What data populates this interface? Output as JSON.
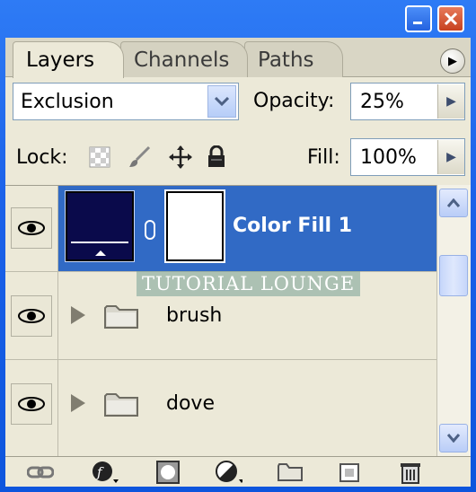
{
  "tabs": [
    {
      "label": "Layers",
      "active": true
    },
    {
      "label": "Channels",
      "active": false
    },
    {
      "label": "Paths",
      "active": false
    }
  ],
  "blend_mode": {
    "value": "Exclusion"
  },
  "opacity": {
    "label": "Opacity:",
    "value": "25%"
  },
  "lock": {
    "label": "Lock:",
    "icons": [
      "transparency-lock-icon",
      "brush-lock-icon",
      "move-lock-icon",
      "padlock-icon"
    ]
  },
  "fill": {
    "label": "Fill:",
    "value": "100%"
  },
  "layers": [
    {
      "name": "Color Fill 1",
      "type": "fill",
      "selected": true,
      "visible": true
    },
    {
      "name": "brush",
      "type": "group",
      "selected": false,
      "visible": true
    },
    {
      "name": "dove",
      "type": "group",
      "selected": false,
      "visible": true
    }
  ],
  "watermark": "TUTORIAL LOUNGE",
  "toolbar_icons": [
    "link-icon",
    "layer-style-icon",
    "mask-icon",
    "adjustment-layer-icon",
    "new-group-icon",
    "new-layer-icon",
    "trash-icon"
  ],
  "colors": {
    "selection": "#316ac5",
    "panel": "#ece9d8",
    "title_bar": "#0a54e4",
    "fill_swatch": "#0a0a4b"
  }
}
